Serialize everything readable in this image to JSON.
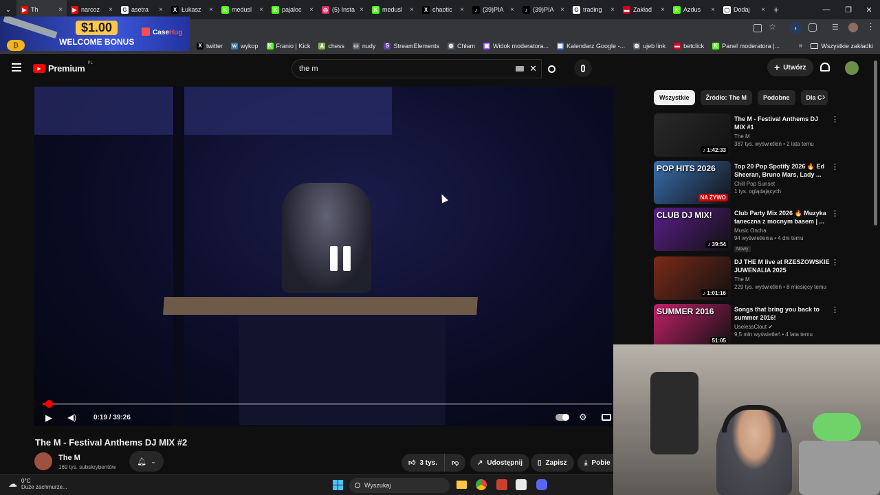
{
  "browser": {
    "tabs": [
      {
        "label": "Th",
        "fav": "#ff0000",
        "glyph": "▶",
        "active": true
      },
      {
        "label": "narcoz",
        "fav": "#ff0000",
        "glyph": "▶"
      },
      {
        "label": "asetra",
        "fav": "#ffffff",
        "glyph": "G"
      },
      {
        "label": "Łukasz",
        "fav": "#000000",
        "glyph": "X"
      },
      {
        "label": "medusl",
        "fav": "#53fc18",
        "glyph": "K"
      },
      {
        "label": "pajaloc",
        "fav": "#53fc18",
        "glyph": "K"
      },
      {
        "label": "(5) Insta",
        "fav": "#e1306c",
        "glyph": "◎"
      },
      {
        "label": "medusl",
        "fav": "#53fc18",
        "glyph": "K"
      },
      {
        "label": "chaotic",
        "fav": "#000000",
        "glyph": "X"
      },
      {
        "label": "(39)PIA",
        "fav": "#000000",
        "glyph": "♪"
      },
      {
        "label": "(39)PIA",
        "fav": "#000000",
        "glyph": "♪"
      },
      {
        "label": "trading",
        "fav": "#ffffff",
        "glyph": "G"
      },
      {
        "label": "Zakład",
        "fav": "#d6001c",
        "glyph": "▬"
      },
      {
        "label": "Azdus",
        "fav": "#53fc18",
        "glyph": "K"
      },
      {
        "label": "Dodaj",
        "fav": "#ffffff",
        "glyph": "▢"
      }
    ],
    "bookmarks": [
      {
        "label": "twitter",
        "fav": "#000000",
        "glyph": "X"
      },
      {
        "label": "wykop",
        "fav": "#367da9",
        "glyph": "w"
      },
      {
        "label": "Franio | Kick",
        "fav": "#53fc18",
        "glyph": "K"
      },
      {
        "label": "chess",
        "fav": "#81b64c",
        "glyph": "♟"
      },
      {
        "label": "nudy",
        "fav": "#5f6368",
        "glyph": "▭"
      },
      {
        "label": "StreamElements",
        "fav": "#6441a5",
        "glyph": "S"
      },
      {
        "label": "Chłam",
        "fav": "#5f6368",
        "glyph": "◍"
      },
      {
        "label": "Widok moderatora...",
        "fav": "#9146ff",
        "glyph": "▣"
      },
      {
        "label": "Kalendarz Google -...",
        "fav": "#4285f4",
        "glyph": "▦"
      },
      {
        "label": "ujeb link",
        "fav": "#5f6368",
        "glyph": "◍"
      },
      {
        "label": "betclick",
        "fav": "#d6001c",
        "glyph": "▬"
      },
      {
        "label": "Panel moderatora |...",
        "fav": "#53fc18",
        "glyph": "K"
      }
    ],
    "all_bookmarks_label": "Wszystkie zakładki"
  },
  "ad": {
    "amount": "$1.00",
    "subtitle": "WELCOME BONUS",
    "brand_a": "Case",
    "brand_b": "Hug"
  },
  "youtube": {
    "logo_label": "Premium",
    "region": "PL",
    "search_value": "the m",
    "create_label": "Utwórz",
    "colors": {
      "accent": "#ff0000",
      "bg": "#0f0f0f"
    }
  },
  "player": {
    "time": "0:19 / 39:26",
    "progress": 0.008
  },
  "video": {
    "title": "The M - Festival Anthems DJ MIX #2",
    "channel": "The M",
    "subscribers": "169 tys. subskrybentów",
    "likes": "3 tys.",
    "share_label": "Udostępnij",
    "save_label": "Zapisz",
    "download_label": "Pobie"
  },
  "sidebar": {
    "chips": [
      {
        "label": "Wszystkie",
        "selected": true
      },
      {
        "label": "Źródło: The M",
        "selected": false
      },
      {
        "label": "Podobne",
        "selected": false
      },
      {
        "label": "Dla C",
        "selected": false
      }
    ],
    "recs": [
      {
        "title": "The M - Festival Anthems DJ MIX #1",
        "channel": "The M",
        "views": "387 tys. wyświetleń • 2 lata temu",
        "duration": "♪ 1:42:33",
        "badge": "",
        "thumb_text": "",
        "thumb": "#2a2a2a"
      },
      {
        "title": "Top 20 Pop Spotify 2026 🔥 Ed Sheeran, Bruno Mars, Lady ...",
        "channel": "Chill Pop Sunset",
        "views": "1 tys. oglądających",
        "duration": "",
        "live": "NA ŻYWO",
        "badge": "",
        "thumb_text": "POP HITS 2026",
        "thumb": "#3a6fb0"
      },
      {
        "title": "Club Party Mix 2026 🔥 Muzyka taneczna z mocnym basem | ...",
        "channel": "Music Oncha",
        "views": "94 wyświetlenia • 4 dni temu",
        "duration": "♪ 39:54",
        "badge": "Nowy",
        "thumb_text": "CLUB DJ MIX!",
        "thumb": "#5a1e8a"
      },
      {
        "title": "DJ THE M live at RZESZOWSKIE JUWENALIA 2025",
        "channel": "The M",
        "views": "229 tys. wyświetleń • 8 miesięcy temu",
        "duration": "♪ 1:01:16",
        "badge": "",
        "thumb_text": "",
        "thumb": "#7a2a18"
      },
      {
        "title": "Songs that bring you back to summer 2016!",
        "channel": "UselessClout ✔",
        "views": "9,5 mln wyświetleń • 4 lata temu",
        "duration": "51:05",
        "badge": "",
        "thumb_text": "SUMMER 2016",
        "thumb": "#c2206a"
      }
    ]
  },
  "taskbar": {
    "weather_temp": "0°C",
    "weather_desc": "Duże zachmurze...",
    "search_placeholder": "Wyszukaj"
  }
}
